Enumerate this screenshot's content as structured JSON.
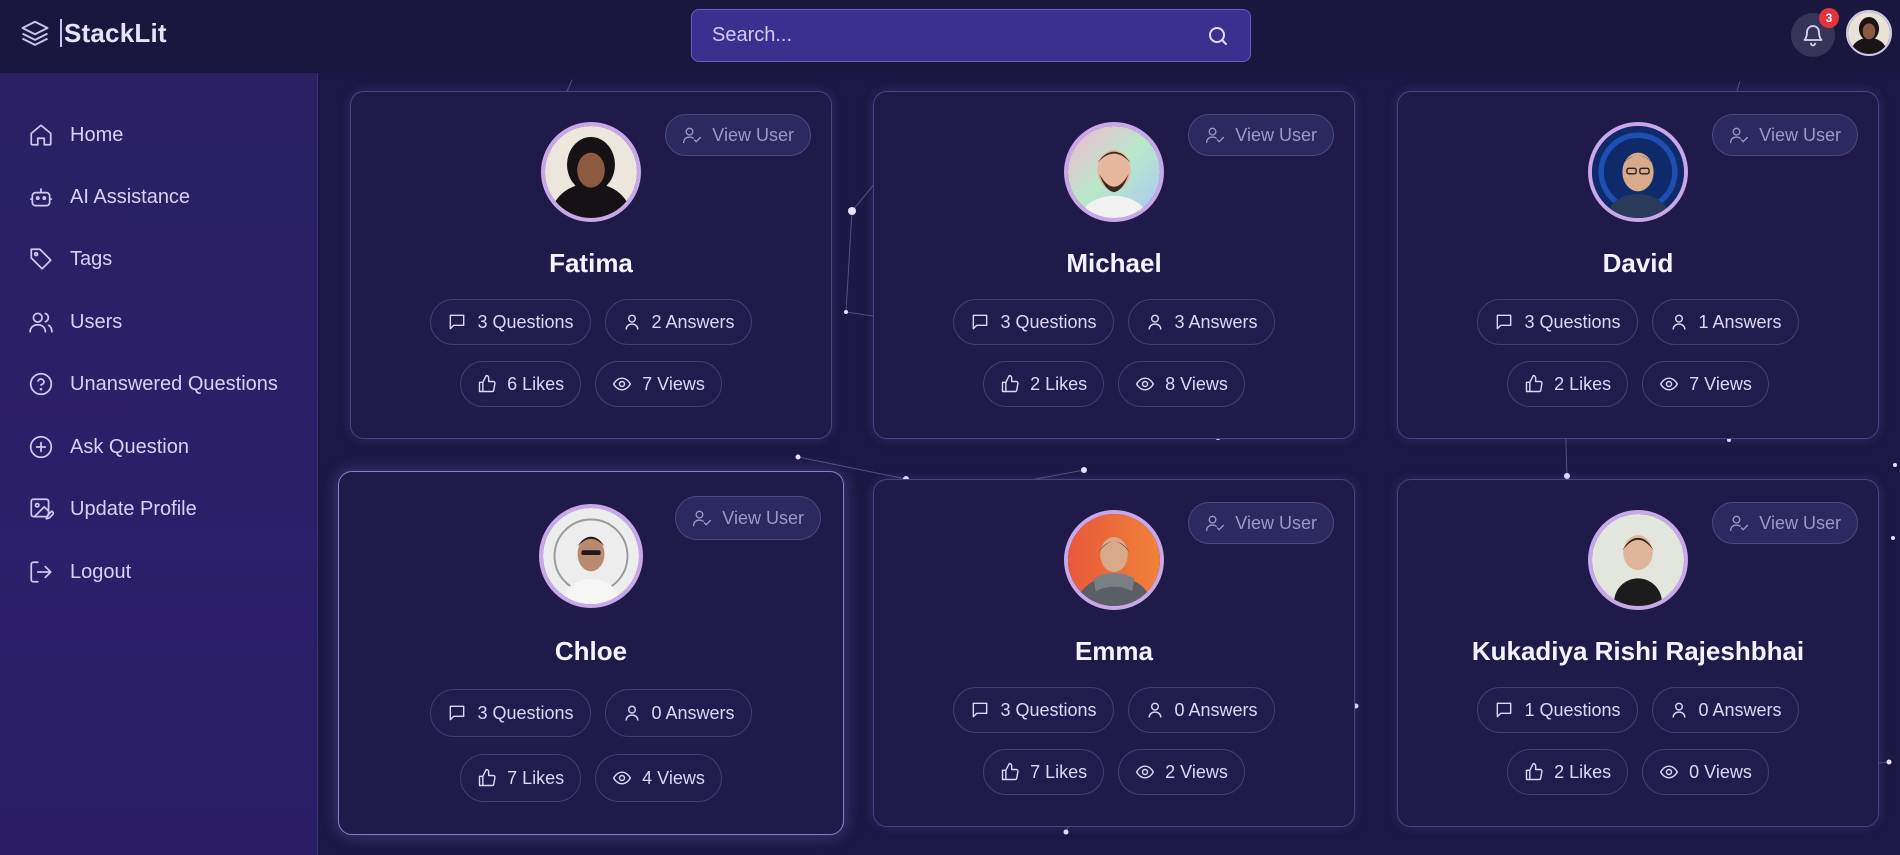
{
  "app": {
    "name": "StackLit"
  },
  "search": {
    "placeholder": "Search..."
  },
  "notifications": {
    "count": "3"
  },
  "sidebar": {
    "items": [
      {
        "label": "Home",
        "icon": "home-icon"
      },
      {
        "label": "AI Assistance",
        "icon": "bot-icon"
      },
      {
        "label": "Tags",
        "icon": "tag-icon"
      },
      {
        "label": "Users",
        "icon": "users-icon"
      },
      {
        "label": "Unanswered Questions",
        "icon": "question-circle-icon"
      },
      {
        "label": "Ask Question",
        "icon": "plus-circle-icon"
      },
      {
        "label": "Update Profile",
        "icon": "image-edit-icon"
      },
      {
        "label": "Logout",
        "icon": "logout-icon"
      }
    ]
  },
  "users": [
    {
      "name": "Fatima",
      "view_label": "View User",
      "questions": "3 Questions",
      "answers": "2 Answers",
      "likes": "6 Likes",
      "views": "7 Views"
    },
    {
      "name": "Michael",
      "view_label": "View User",
      "questions": "3 Questions",
      "answers": "3 Answers",
      "likes": "2 Likes",
      "views": "8 Views"
    },
    {
      "name": "David",
      "view_label": "View User",
      "questions": "3 Questions",
      "answers": "1 Answers",
      "likes": "2 Likes",
      "views": "7 Views"
    },
    {
      "name": "Chloe",
      "view_label": "View User",
      "questions": "3 Questions",
      "answers": "0 Answers",
      "likes": "7 Likes",
      "views": "4 Views"
    },
    {
      "name": "Emma",
      "view_label": "View User",
      "questions": "3 Questions",
      "answers": "0 Answers",
      "likes": "7 Likes",
      "views": "2 Views"
    },
    {
      "name": "Kukadiya Rishi Rajeshbhai",
      "view_label": "View User",
      "questions": "1 Questions",
      "answers": "0 Answers",
      "likes": "2 Likes",
      "views": "0 Views"
    }
  ]
}
